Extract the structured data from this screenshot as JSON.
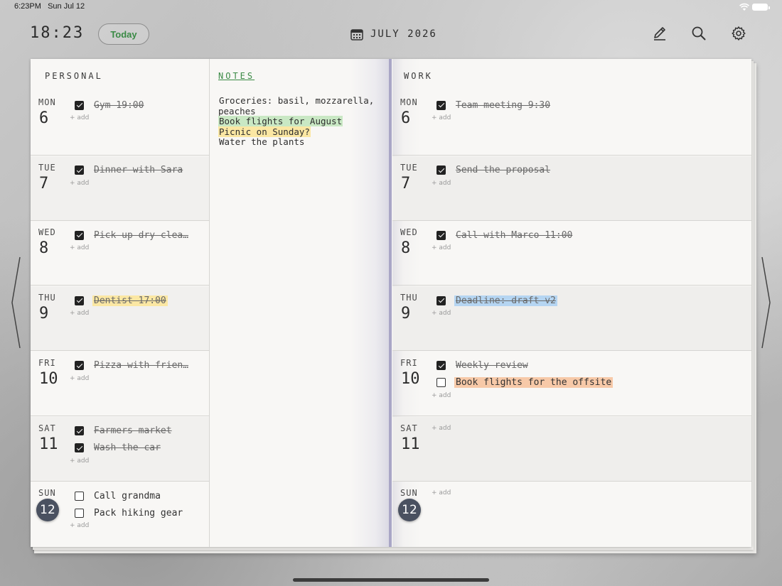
{
  "status_bar": {
    "time": "6:23PM",
    "date": "Sun Jul 12"
  },
  "toolbar": {
    "clock": "18:23",
    "today_label": "Today",
    "month_label": "JULY 2026",
    "icons": [
      "pencil-icon",
      "search-icon",
      "gear-icon"
    ]
  },
  "personal": {
    "header": "PERSONAL",
    "add_label": "+ add",
    "days": [
      {
        "dow": "MON",
        "num": "6",
        "tasks": [
          {
            "text": "Gym 19:00",
            "done": true
          }
        ]
      },
      {
        "dow": "TUE",
        "num": "7",
        "tasks": [
          {
            "text": "Dinner with Sara",
            "done": true
          }
        ]
      },
      {
        "dow": "WED",
        "num": "8",
        "tasks": [
          {
            "text": "Pick up dry clea…",
            "done": true
          }
        ]
      },
      {
        "dow": "THU",
        "num": "9",
        "tasks": [
          {
            "text": "Dentist 17:00",
            "done": true,
            "highlight": "yellow"
          }
        ]
      },
      {
        "dow": "FRI",
        "num": "10",
        "tasks": [
          {
            "text": "Pizza with frien…",
            "done": true
          }
        ]
      },
      {
        "dow": "SAT",
        "num": "11",
        "tasks": [
          {
            "text": "Farmers market",
            "done": true
          },
          {
            "text": "Wash the car",
            "done": true
          }
        ]
      },
      {
        "dow": "SUN",
        "num": "12",
        "today": true,
        "tasks": [
          {
            "text": "Call grandma",
            "done": false
          },
          {
            "text": "Pack hiking gear",
            "done": false
          }
        ]
      }
    ]
  },
  "notes": {
    "header": "NOTES",
    "lines": [
      {
        "text": "Groceries: basil, mozzarella, peaches"
      },
      {
        "text": "Book flights for August",
        "highlight": "green"
      },
      {
        "text": "Picnic on Sunday?",
        "highlight": "yellow"
      },
      {
        "text": "Water the plants"
      }
    ]
  },
  "work": {
    "header": "WORK",
    "add_label": "+ add",
    "days": [
      {
        "dow": "MON",
        "num": "6",
        "tasks": [
          {
            "text": "Team meeting 9:30",
            "done": true
          }
        ]
      },
      {
        "dow": "TUE",
        "num": "7",
        "tasks": [
          {
            "text": "Send the proposal",
            "done": true
          }
        ]
      },
      {
        "dow": "WED",
        "num": "8",
        "tasks": [
          {
            "text": "Call with Marco 11:00",
            "done": true
          }
        ]
      },
      {
        "dow": "THU",
        "num": "9",
        "tasks": [
          {
            "text": "Deadline: draft v2",
            "done": true,
            "highlight": "blue"
          }
        ]
      },
      {
        "dow": "FRI",
        "num": "10",
        "tasks": [
          {
            "text": "Weekly review",
            "done": true
          },
          {
            "text": "Book flights for the offsite",
            "done": false,
            "highlight": "orange"
          }
        ]
      },
      {
        "dow": "SAT",
        "num": "11",
        "tasks": []
      },
      {
        "dow": "SUN",
        "num": "12",
        "today": true,
        "tasks": []
      }
    ]
  },
  "colors": {
    "accent_green": "#3a8a45",
    "today_circle": "#4a5160",
    "highlight_yellow": "#fbe7a3",
    "highlight_green": "#c9e8c4",
    "highlight_blue": "#b5d5f2",
    "highlight_orange": "#f7c9a8"
  }
}
